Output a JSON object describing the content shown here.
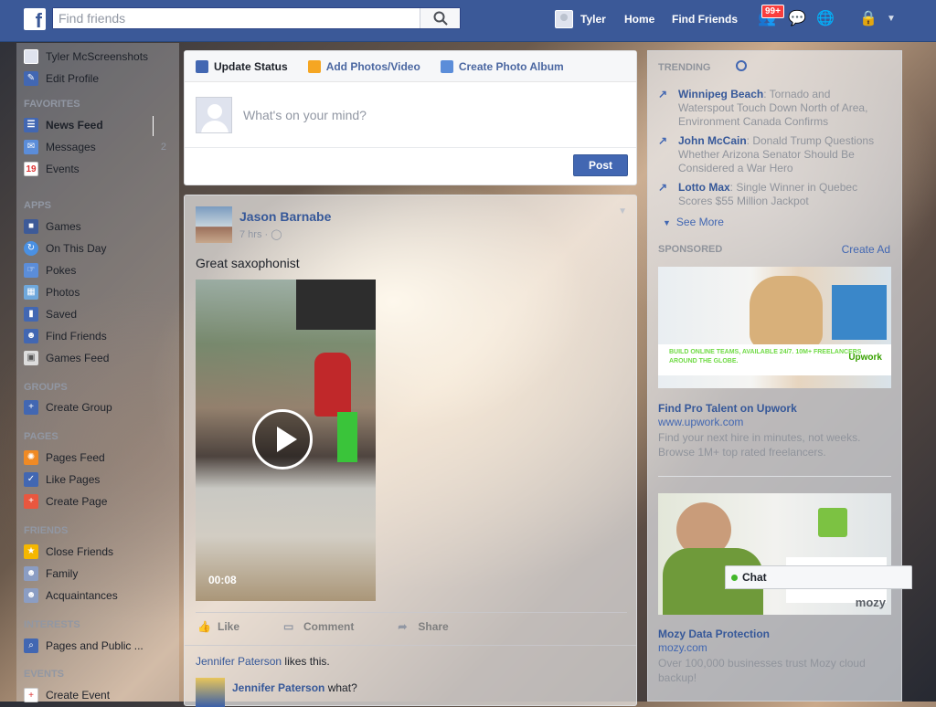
{
  "topbar": {
    "search_placeholder": "Find friends",
    "user_name": "Tyler",
    "home_label": "Home",
    "find_friends_label": "Find Friends",
    "notifications_badge": "99+",
    "brand_color": "#3b5998"
  },
  "sidebar": {
    "profile_name": "Tyler McScreenshots",
    "edit_profile": "Edit Profile",
    "sections": {
      "favorites": "FAVORITES",
      "apps": "APPS",
      "groups": "GROUPS",
      "pages": "PAGES",
      "friends": "FRIENDS",
      "interests": "INTERESTS",
      "events": "EVENTS"
    },
    "favorites": [
      "News Feed",
      "Messages",
      "Events"
    ],
    "messages_count": "2",
    "apps": [
      "Games",
      "On This Day",
      "Pokes",
      "Photos",
      "Saved",
      "Find Friends",
      "Games Feed"
    ],
    "groups": [
      "Create Group"
    ],
    "pages": [
      "Pages Feed",
      "Like Pages",
      "Create Page"
    ],
    "friends": [
      "Close Friends",
      "Family",
      "Acquaintances"
    ],
    "interests": [
      "Pages and Public ..."
    ],
    "events": [
      "Create Event"
    ]
  },
  "composer": {
    "tabs": [
      "Update Status",
      "Add Photos/Video",
      "Create Photo Album"
    ],
    "placeholder": "What's on your mind?",
    "post_button": "Post"
  },
  "story": {
    "author": "Jason Barnabe",
    "time": "7 hrs",
    "text": "Great saxophonist",
    "video_duration": "00:08",
    "actions": [
      "Like",
      "Comment",
      "Share"
    ],
    "liker": "Jennifer Paterson",
    "likes_suffix": "likes this.",
    "comment_author": "Jennifer Paterson",
    "comment_text": "what?"
  },
  "right": {
    "trending_label": "TRENDING",
    "trends": [
      {
        "topic": "Winnipeg Beach",
        "desc": ": Tornado and Waterspout Touch Down North of Area, Environment Canada Confirms"
      },
      {
        "topic": "John McCain",
        "desc": ": Donald Trump Questions Whether Arizona Senator Should Be Considered a War Hero"
      },
      {
        "topic": "Lotto Max",
        "desc": ": Single Winner in Quebec Scores $55 Million Jackpot"
      }
    ],
    "see_more": "See More",
    "sponsored_label": "SPONSORED",
    "create_ad": "Create Ad",
    "ads": [
      {
        "banner": "BUILD ONLINE TEAMS, AVAILABLE 24/7. 10M+ FREELANCERS AROUND THE GLOBE.",
        "brand": "Upwork",
        "title": "Find Pro Talent on Upwork",
        "url": "www.upwork.com",
        "desc": "Find your next hire in minutes, not weeks. Browse 1M+ top rated freelancers."
      },
      {
        "brand": "mozy",
        "title": "Mozy Data Protection",
        "url": "mozy.com",
        "desc": "Over 100,000 businesses trust Mozy cloud backup!"
      }
    ]
  },
  "chat": {
    "label": "Chat"
  }
}
